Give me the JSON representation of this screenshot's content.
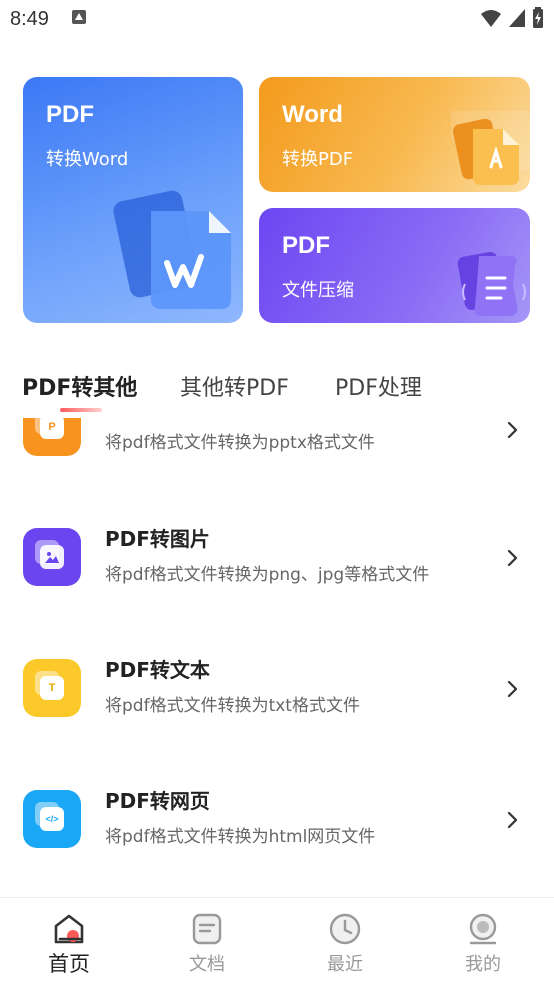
{
  "status_bar": {
    "time": "8:49"
  },
  "cards": {
    "pdf_to_word": {
      "title": "PDF",
      "subtitle": "转换Word"
    },
    "word_to_pdf": {
      "title": "Word",
      "subtitle": "转换PDF"
    },
    "pdf_compress": {
      "title": "PDF",
      "subtitle": "文件压缩"
    }
  },
  "tabs": [
    {
      "label": "PDF转其他",
      "active": true
    },
    {
      "label": "其他转PDF",
      "active": false
    },
    {
      "label": "PDF处理",
      "active": false
    }
  ],
  "list": [
    {
      "title": "",
      "desc": "将pdf格式文件转换为pptx格式文件",
      "icon": "ppt-icon",
      "color": "#f7931e",
      "letter": "P"
    },
    {
      "title": "PDF转图片",
      "desc": "将pdf格式文件转换为png、jpg等格式文件",
      "icon": "image-icon",
      "color": "#6a45f0",
      "letter": ""
    },
    {
      "title": "PDF转文本",
      "desc": "将pdf格式文件转换为txt格式文件",
      "icon": "text-icon",
      "color": "#fcc92a",
      "letter": "T"
    },
    {
      "title": "PDF转网页",
      "desc": "将pdf格式文件转换为html网页文件",
      "icon": "html-icon",
      "color": "#1aa7f5",
      "letter": "</>"
    }
  ],
  "bottom_nav": [
    {
      "label": "首页",
      "icon": "home-icon",
      "active": true
    },
    {
      "label": "文档",
      "icon": "document-icon",
      "active": false
    },
    {
      "label": "最近",
      "icon": "clock-icon",
      "active": false
    },
    {
      "label": "我的",
      "icon": "profile-icon",
      "active": false
    }
  ],
  "colors": {
    "accent_red": "#ff5a5a",
    "card_blue": "#3b78f5",
    "card_orange": "#f39a1c",
    "card_purple": "#6c46f2"
  }
}
